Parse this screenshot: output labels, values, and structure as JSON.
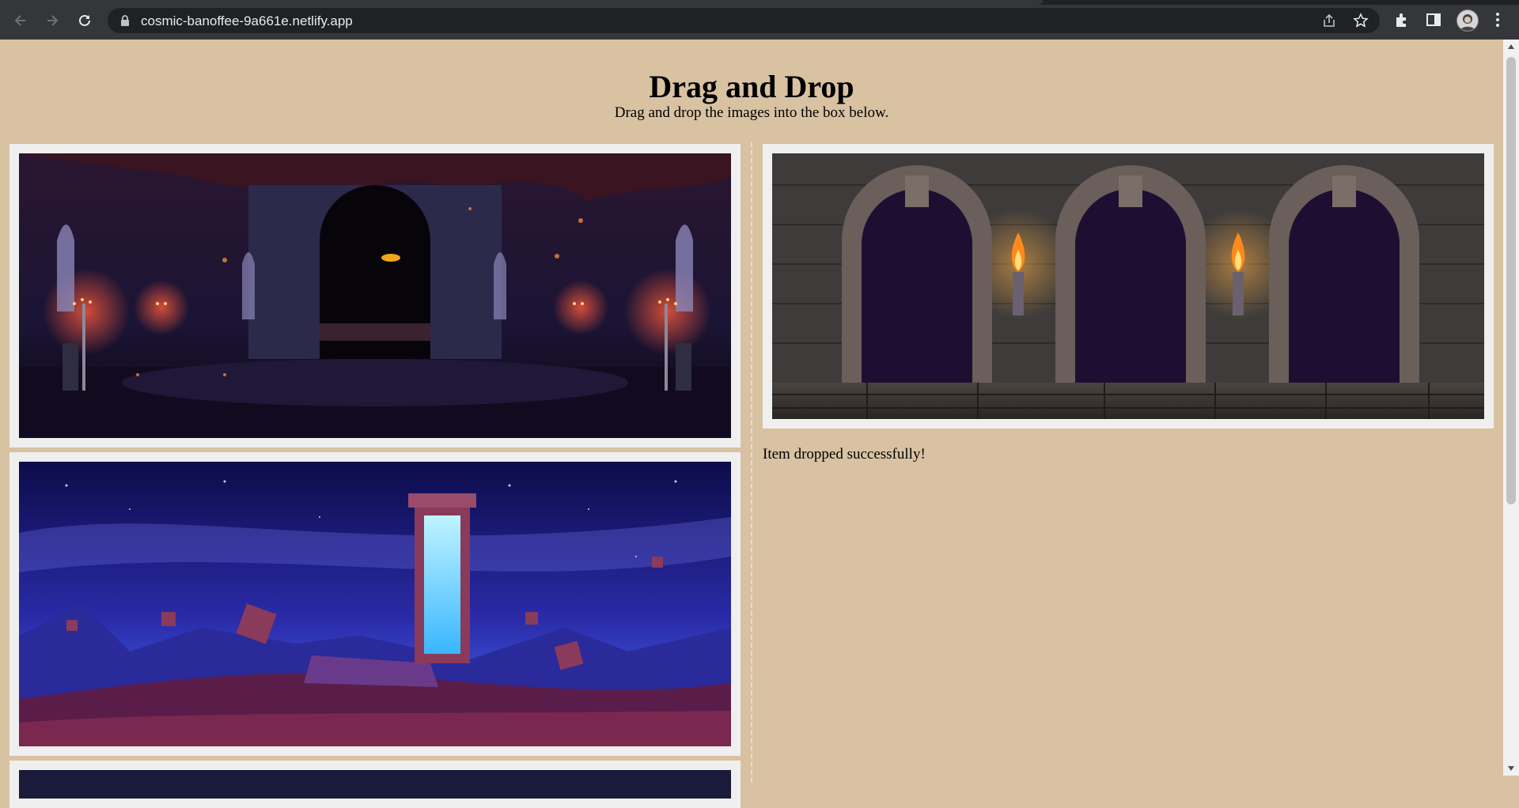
{
  "browser": {
    "url": "cosmic-banoffee-9a661e.netlify.app",
    "icons": [
      "back-icon",
      "forward-icon",
      "reload-icon",
      "lock-icon",
      "share-icon",
      "bookmark-star-icon",
      "extensions-icon",
      "side-panel-icon",
      "profile-avatar",
      "menu-dots-icon"
    ]
  },
  "page": {
    "title": "Drag and Drop",
    "subtitle": "Drag and drop the images into the box below.",
    "status": "Item dropped successfully!"
  },
  "images": {
    "source": [
      {
        "name": "haunted-castle-hall-image",
        "theme": "dark gothic hall with candelabras and glowing eye"
      },
      {
        "name": "space-portal-image",
        "theme": "blue glowing portal on floating rocks under starry sky"
      },
      {
        "name": "third-image-partial",
        "theme": "partially visible"
      }
    ],
    "dropped": [
      {
        "name": "dungeon-arches-image",
        "theme": "stone dungeon wall with three arches and two torches"
      }
    ]
  },
  "colors": {
    "background": "#d8c2a2",
    "card": "#efefef",
    "chrome": "#35363a"
  }
}
